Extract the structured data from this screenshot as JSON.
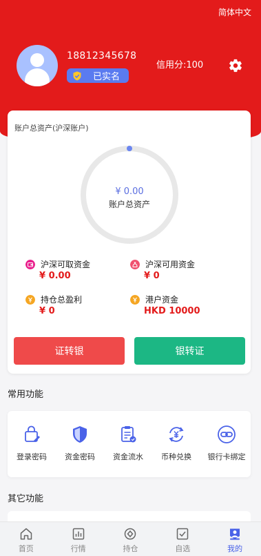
{
  "header": {
    "language": "简体中文",
    "phone": "18812345678",
    "verified_label": "已实名",
    "credit": "信用分:100"
  },
  "assets": {
    "title": "账户总资产(沪深账户)",
    "total_amount": "¥  0.00",
    "total_label": "账户总资产",
    "ring_progress": 0,
    "stats": [
      {
        "label": "沪深可取资金",
        "value": "¥ 0.00",
        "icon": "wallet-icon",
        "color": "#e91e8c"
      },
      {
        "label": "沪深可用资金",
        "value": "¥ 0",
        "icon": "money-bag-icon",
        "color": "#f0506e"
      },
      {
        "label": "持仓总盈利",
        "value": "¥ 0",
        "icon": "coin-icon",
        "color": "#f5a623"
      },
      {
        "label": "港户资金",
        "value": "HKD 10000",
        "icon": "coin-icon",
        "color": "#f5a623"
      }
    ],
    "transfer_out": "证转银",
    "transfer_in": "银转证"
  },
  "common": {
    "title": "常用功能",
    "items": [
      {
        "label": "登录密码",
        "icon": "lock-bag-icon"
      },
      {
        "label": "资金密码",
        "icon": "shield-icon"
      },
      {
        "label": "资金流水",
        "icon": "clipboard-icon"
      },
      {
        "label": "币种兑换",
        "icon": "exchange-icon"
      },
      {
        "label": "银行卡绑定",
        "icon": "link-icon"
      }
    ]
  },
  "other": {
    "title": "其它功能"
  },
  "tabs": [
    {
      "label": "首页",
      "icon": "home-icon"
    },
    {
      "label": "行情",
      "icon": "chart-icon"
    },
    {
      "label": "持仓",
      "icon": "position-icon"
    },
    {
      "label": "自选",
      "icon": "checkbox-icon"
    },
    {
      "label": "我的",
      "icon": "user-icon"
    }
  ],
  "colors": {
    "brand_red": "#e31b1b",
    "accent_blue": "#4a62e8",
    "green": "#1cb784"
  }
}
